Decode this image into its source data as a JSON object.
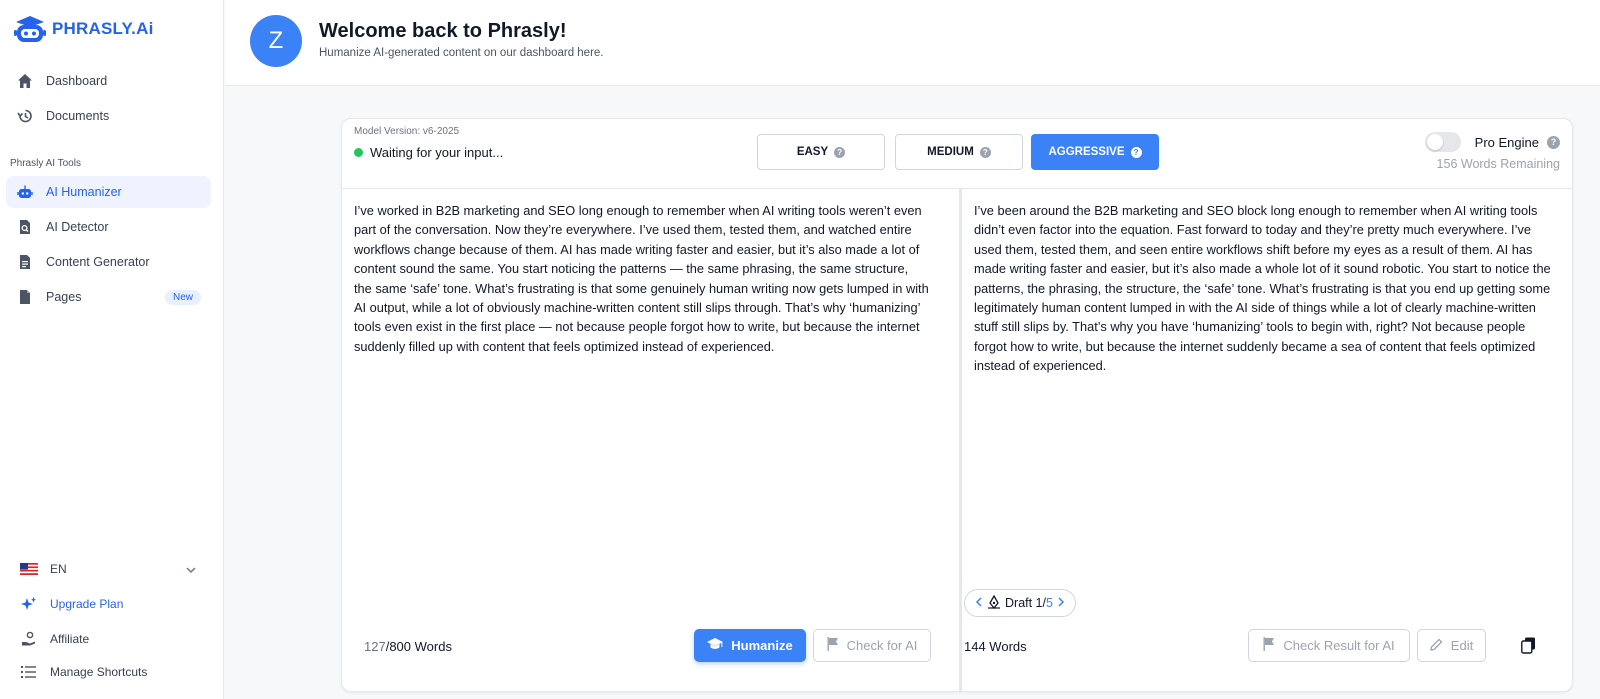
{
  "app": {
    "logo_text": "PHRASLY.Ai"
  },
  "sidebar": {
    "nav": [
      {
        "label": "Dashboard",
        "icon": "home-icon"
      },
      {
        "label": "Documents",
        "icon": "history-icon"
      }
    ],
    "section_label": "Phrasly AI Tools",
    "tools": [
      {
        "label": "AI Humanizer",
        "icon": "robot-icon",
        "active": true
      },
      {
        "label": "AI Detector",
        "icon": "search-document-icon"
      },
      {
        "label": "Content Generator",
        "icon": "document-icon"
      },
      {
        "label": "Pages",
        "icon": "page-icon",
        "badge": "New"
      }
    ],
    "language": "EN",
    "upgrade_label": "Upgrade Plan",
    "affiliate_label": "Affiliate",
    "shortcuts_label": "Manage Shortcuts"
  },
  "header": {
    "avatar_letter": "Z",
    "title": "Welcome back to Phrasly!",
    "subtitle": "Humanize AI-generated content on our dashboard here."
  },
  "editor": {
    "model_version": "Model Version: v6-2025",
    "status": "Waiting for your input...",
    "modes": [
      {
        "label": "EASY",
        "active": false
      },
      {
        "label": "MEDIUM",
        "active": false
      },
      {
        "label": "AGGRESSIVE",
        "active": true
      }
    ],
    "pro_engine_label": "Pro Engine",
    "pro_engine_enabled": false,
    "words_remaining": "156 Words Remaining",
    "input_text": "I’ve worked in B2B marketing and SEO long enough to remember when AI writing tools weren’t even part of the conversation. Now they’re everywhere. I’ve used them, tested them, and watched entire workflows change because of them. AI has made writing faster and easier, but it’s also made a lot of content sound the same. You start noticing the patterns — the same phrasing, the same structure, the same ‘safe’ tone. What’s frustrating is that some genuinely human writing now gets lumped in with AI output, while a lot of obviously machine-written content still slips through. That’s why ‘humanizing’ tools even exist in the first place — not because people forgot how to write, but because the internet suddenly filled up with content that feels optimized instead of experienced.",
    "output_text": "I’ve been around the B2B marketing and SEO block long enough to remember when AI writing tools didn’t even factor into the equation. Fast forward to today and they’re pretty much everywhere. I’ve used them, tested them, and seen entire workflows shift before my eyes as a result of them. AI has made writing faster and easier, but it’s also made a whole lot of it sound robotic. You start to notice the patterns, the phrasing, the structure, the ‘safe’ tone. What’s frustrating is that you end up getting some legitimately human content lumped in with the AI side of things while a lot of clearly machine-written stuff still slips by. That’s why you have ‘humanizing’ tools to begin with, right? Not because people forgot how to write, but because the internet suddenly became a sea of content that feels optimized instead of experienced.",
    "input_count": "127",
    "input_limit": "/800 Words",
    "humanize_label": "Humanize",
    "check_ai_label": "Check for AI",
    "draft_label": "Draft 1/",
    "draft_total": "5",
    "output_count": "144 Words",
    "check_result_label": "Check Result for AI",
    "edit_label": "Edit"
  },
  "colors": {
    "accent": "#3b82f6",
    "brand": "#2563eb",
    "status_ok": "#22c55e"
  }
}
